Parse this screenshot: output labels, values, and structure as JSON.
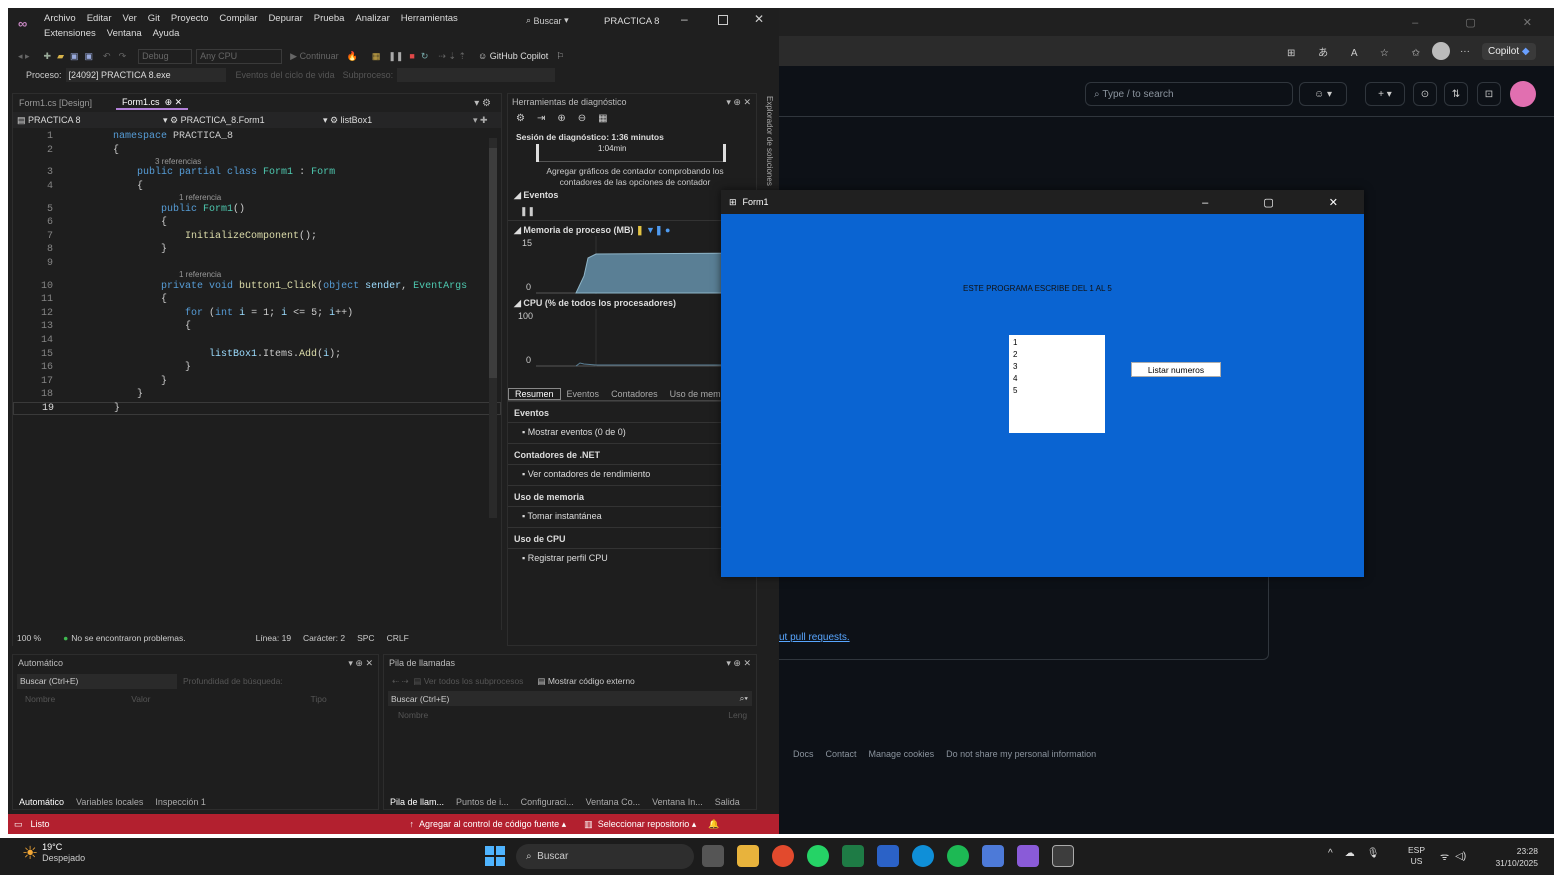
{
  "vs": {
    "menu_row1": [
      "Archivo",
      "Editar",
      "Ver",
      "Git",
      "Proyecto",
      "Compilar",
      "Depurar",
      "Prueba",
      "Analizar",
      "Herramientas"
    ],
    "menu_row2": [
      "Extensiones",
      "Ventana",
      "Ayuda"
    ],
    "search_label": "Buscar",
    "solution_title": "PRACTICA 8",
    "toolbar": {
      "config": "Debug",
      "platform": "Any CPU",
      "continue": "Continuar",
      "copilot": "GitHub Copilot"
    },
    "process_label": "Proceso:",
    "process_value": "[24092] PRACTICA 8.exe",
    "lifecycle_label": "Eventos del ciclo de vida",
    "thread_label": "Subproceso:",
    "tabs": [
      {
        "label": "Form1.cs [Design]"
      },
      {
        "label": "Form1.cs"
      }
    ],
    "nav": {
      "project": "PRACTICA 8",
      "class": "PRACTICA_8.Form1",
      "member": "listBox1"
    },
    "code_lines": [
      {
        "n": "1",
        "ref": "",
        "segs": [
          [
            "kw",
            "namespace "
          ],
          [
            "",
            "PRACTICA_8"
          ]
        ]
      },
      {
        "n": "2",
        "ref": "",
        "segs": [
          [
            "",
            "{"
          ]
        ]
      },
      {
        "n": "3",
        "ref": "3 referencias",
        "segs": [
          [
            "",
            "    "
          ],
          [
            "kw",
            "public partial class "
          ],
          [
            "ty",
            "Form1"
          ],
          [
            "",
            " : "
          ],
          [
            "ty",
            "Form"
          ]
        ]
      },
      {
        "n": "4",
        "ref": "",
        "segs": [
          [
            "",
            "    {"
          ]
        ]
      },
      {
        "n": "5",
        "ref": "1 referencia",
        "segs": [
          [
            "",
            "        "
          ],
          [
            "kw",
            "public "
          ],
          [
            "ty",
            "Form1"
          ],
          [
            "",
            "()"
          ]
        ]
      },
      {
        "n": "6",
        "ref": "",
        "segs": [
          [
            "",
            "        {"
          ]
        ]
      },
      {
        "n": "7",
        "ref": "",
        "segs": [
          [
            "",
            "            "
          ],
          [
            "mt",
            "InitializeComponent"
          ],
          [
            "",
            "();"
          ]
        ]
      },
      {
        "n": "8",
        "ref": "",
        "segs": [
          [
            "",
            "        }"
          ]
        ]
      },
      {
        "n": "9",
        "ref": "",
        "segs": [
          [
            "",
            ""
          ]
        ]
      },
      {
        "n": "10",
        "ref": "1 referencia",
        "segs": [
          [
            "",
            "        "
          ],
          [
            "kw",
            "private void "
          ],
          [
            "mt",
            "button1_Click"
          ],
          [
            "",
            "("
          ],
          [
            "kw",
            "object "
          ],
          [
            "pm",
            "sender"
          ],
          [
            "",
            ", "
          ],
          [
            "ty",
            "EventArgs"
          ]
        ]
      },
      {
        "n": "11",
        "ref": "",
        "segs": [
          [
            "",
            "        {"
          ]
        ]
      },
      {
        "n": "12",
        "ref": "",
        "segs": [
          [
            "",
            "            "
          ],
          [
            "kw",
            "for "
          ],
          [
            "",
            "("
          ],
          [
            "kw",
            "int "
          ],
          [
            "pm",
            "i"
          ],
          [
            "",
            " = 1; "
          ],
          [
            "pm",
            "i"
          ],
          [
            "",
            " <= 5; "
          ],
          [
            "pm",
            "i"
          ],
          [
            "",
            "++)"
          ]
        ]
      },
      {
        "n": "13",
        "ref": "",
        "segs": [
          [
            "",
            "            {"
          ]
        ]
      },
      {
        "n": "14",
        "ref": "",
        "segs": [
          [
            "",
            ""
          ]
        ]
      },
      {
        "n": "15",
        "ref": "",
        "segs": [
          [
            "",
            "                "
          ],
          [
            "pm",
            "listBox1"
          ],
          [
            "",
            ".Items."
          ],
          [
            "mt",
            "Add"
          ],
          [
            "",
            "("
          ],
          [
            "pm",
            "i"
          ],
          [
            "",
            ");"
          ]
        ]
      },
      {
        "n": "16",
        "ref": "",
        "segs": [
          [
            "",
            "            }"
          ]
        ]
      },
      {
        "n": "17",
        "ref": "",
        "segs": [
          [
            "",
            "        }"
          ]
        ]
      },
      {
        "n": "18",
        "ref": "",
        "segs": [
          [
            "",
            "    }"
          ]
        ]
      },
      {
        "n": "19",
        "ref": "",
        "segs": [
          [
            "",
            "}"
          ]
        ]
      }
    ],
    "status": {
      "zoom": "100 %",
      "problems": "No se encontraron problemas.",
      "line": "Línea: 19",
      "char": "Carácter: 2",
      "spc": "SPC",
      "crlf": "CRLF"
    },
    "diag": {
      "title": "Herramientas de diagnóstico",
      "session": "Sesión de diagnóstico: 1:36 minutos",
      "time_mark": "1:04min",
      "hint": "Agregar gráficos de contador comprobando los contadores de las opciones de contador",
      "events_hdr": "Eventos",
      "mem_hdr": "Memoria de proceso (MB)",
      "mem_max": "15",
      "mem_min": "0",
      "cpu_hdr": "CPU (% de todos los procesadores)",
      "cpu_max": "100",
      "cpu_min": "0",
      "tabs": [
        "Resumen",
        "Eventos",
        "Contadores",
        "Uso de mem"
      ],
      "sections": [
        {
          "title": "Eventos",
          "item": "Mostrar eventos (0 de 0)"
        },
        {
          "title": "Contadores de .NET",
          "item": "Ver contadores de rendimiento"
        },
        {
          "title": "Uso de memoria",
          "item": "Tomar instantánea"
        },
        {
          "title": "Uso de CPU",
          "item": "Registrar perfil CPU"
        }
      ],
      "side_tab": "Explorador de soluciones"
    },
    "auto": {
      "title": "Automático",
      "search": "Buscar (Ctrl+E)",
      "depth": "Profundidad de búsqueda:",
      "cols": [
        "Nombre",
        "Valor",
        "Tipo"
      ],
      "tabs": [
        "Automático",
        "Variables locales",
        "Inspección 1"
      ]
    },
    "calls": {
      "title": "Pila de llamadas",
      "all_threads": "Ver todos los subprocesos",
      "external": "Mostrar código externo",
      "search": "Buscar (Ctrl+E)",
      "cols": [
        "Nombre",
        "Leng"
      ],
      "tabs": [
        "Pila de llam...",
        "Puntos de i...",
        "Configuraci...",
        "Ventana Co...",
        "Ventana In...",
        "Salida"
      ]
    },
    "statusbar": {
      "ready": "Listo",
      "source": "Agregar al control de código fuente",
      "repo": "Seleccionar repositorio"
    }
  },
  "edge": {
    "search_placeholder": "Type / to search",
    "copilot": "Copilot",
    "link": "ut pull requests.",
    "footer": [
      "Docs",
      "Contact",
      "Manage cookies",
      "Do not share my personal information"
    ]
  },
  "form": {
    "title": "Form1",
    "label": "ESTE PROGRAMA ESCRIBE DEL 1 AL 5",
    "items": [
      "1",
      "2",
      "3",
      "4",
      "5"
    ],
    "button": "Listar numeros"
  },
  "taskbar": {
    "temp": "19°C",
    "weather": "Despejado",
    "search": "Buscar",
    "lang1": "ESP",
    "lang2": "US",
    "time": "23:28",
    "date": "31/10/2025"
  },
  "colors": {
    "form_bg": "#0a64d2",
    "vs_status": "#b3202f",
    "accent": "#0e639c"
  }
}
